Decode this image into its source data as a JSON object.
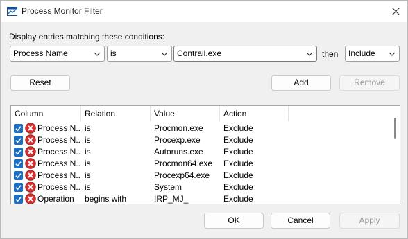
{
  "window": {
    "title": "Process Monitor Filter"
  },
  "conditions_label": "Display entries matching these conditions:",
  "filter": {
    "column_value": "Process Name",
    "relation_value": "is",
    "value": "Contrail.exe",
    "then_label": "then",
    "action_value": "Include"
  },
  "buttons": {
    "reset": "Reset",
    "add": "Add",
    "remove": "Remove",
    "ok": "OK",
    "cancel": "Cancel",
    "apply": "Apply"
  },
  "table": {
    "headers": [
      "Column",
      "Relation",
      "Value",
      "Action"
    ],
    "rows": [
      {
        "column": "Process N...",
        "relation": "is",
        "value": "Procmon.exe",
        "action": "Exclude",
        "checked": true
      },
      {
        "column": "Process N...",
        "relation": "is",
        "value": "Procexp.exe",
        "action": "Exclude",
        "checked": true
      },
      {
        "column": "Process N...",
        "relation": "is",
        "value": "Autoruns.exe",
        "action": "Exclude",
        "checked": true
      },
      {
        "column": "Process N...",
        "relation": "is",
        "value": "Procmon64.exe",
        "action": "Exclude",
        "checked": true
      },
      {
        "column": "Process N...",
        "relation": "is",
        "value": "Procexp64.exe",
        "action": "Exclude",
        "checked": true
      },
      {
        "column": "Process N...",
        "relation": "is",
        "value": "System",
        "action": "Exclude",
        "checked": true
      },
      {
        "column": "Operation",
        "relation": "begins with",
        "value": "IRP_MJ_",
        "action": "Exclude",
        "checked": true
      }
    ]
  },
  "icons": {
    "app": "filter-app-icon",
    "close": "close-icon",
    "row_checkbox": "checkbox-checked-icon",
    "row_status": "exclude-x-icon"
  },
  "colors": {
    "accent": "#1a6fc4",
    "exclude_icon": "#d32f2f"
  }
}
